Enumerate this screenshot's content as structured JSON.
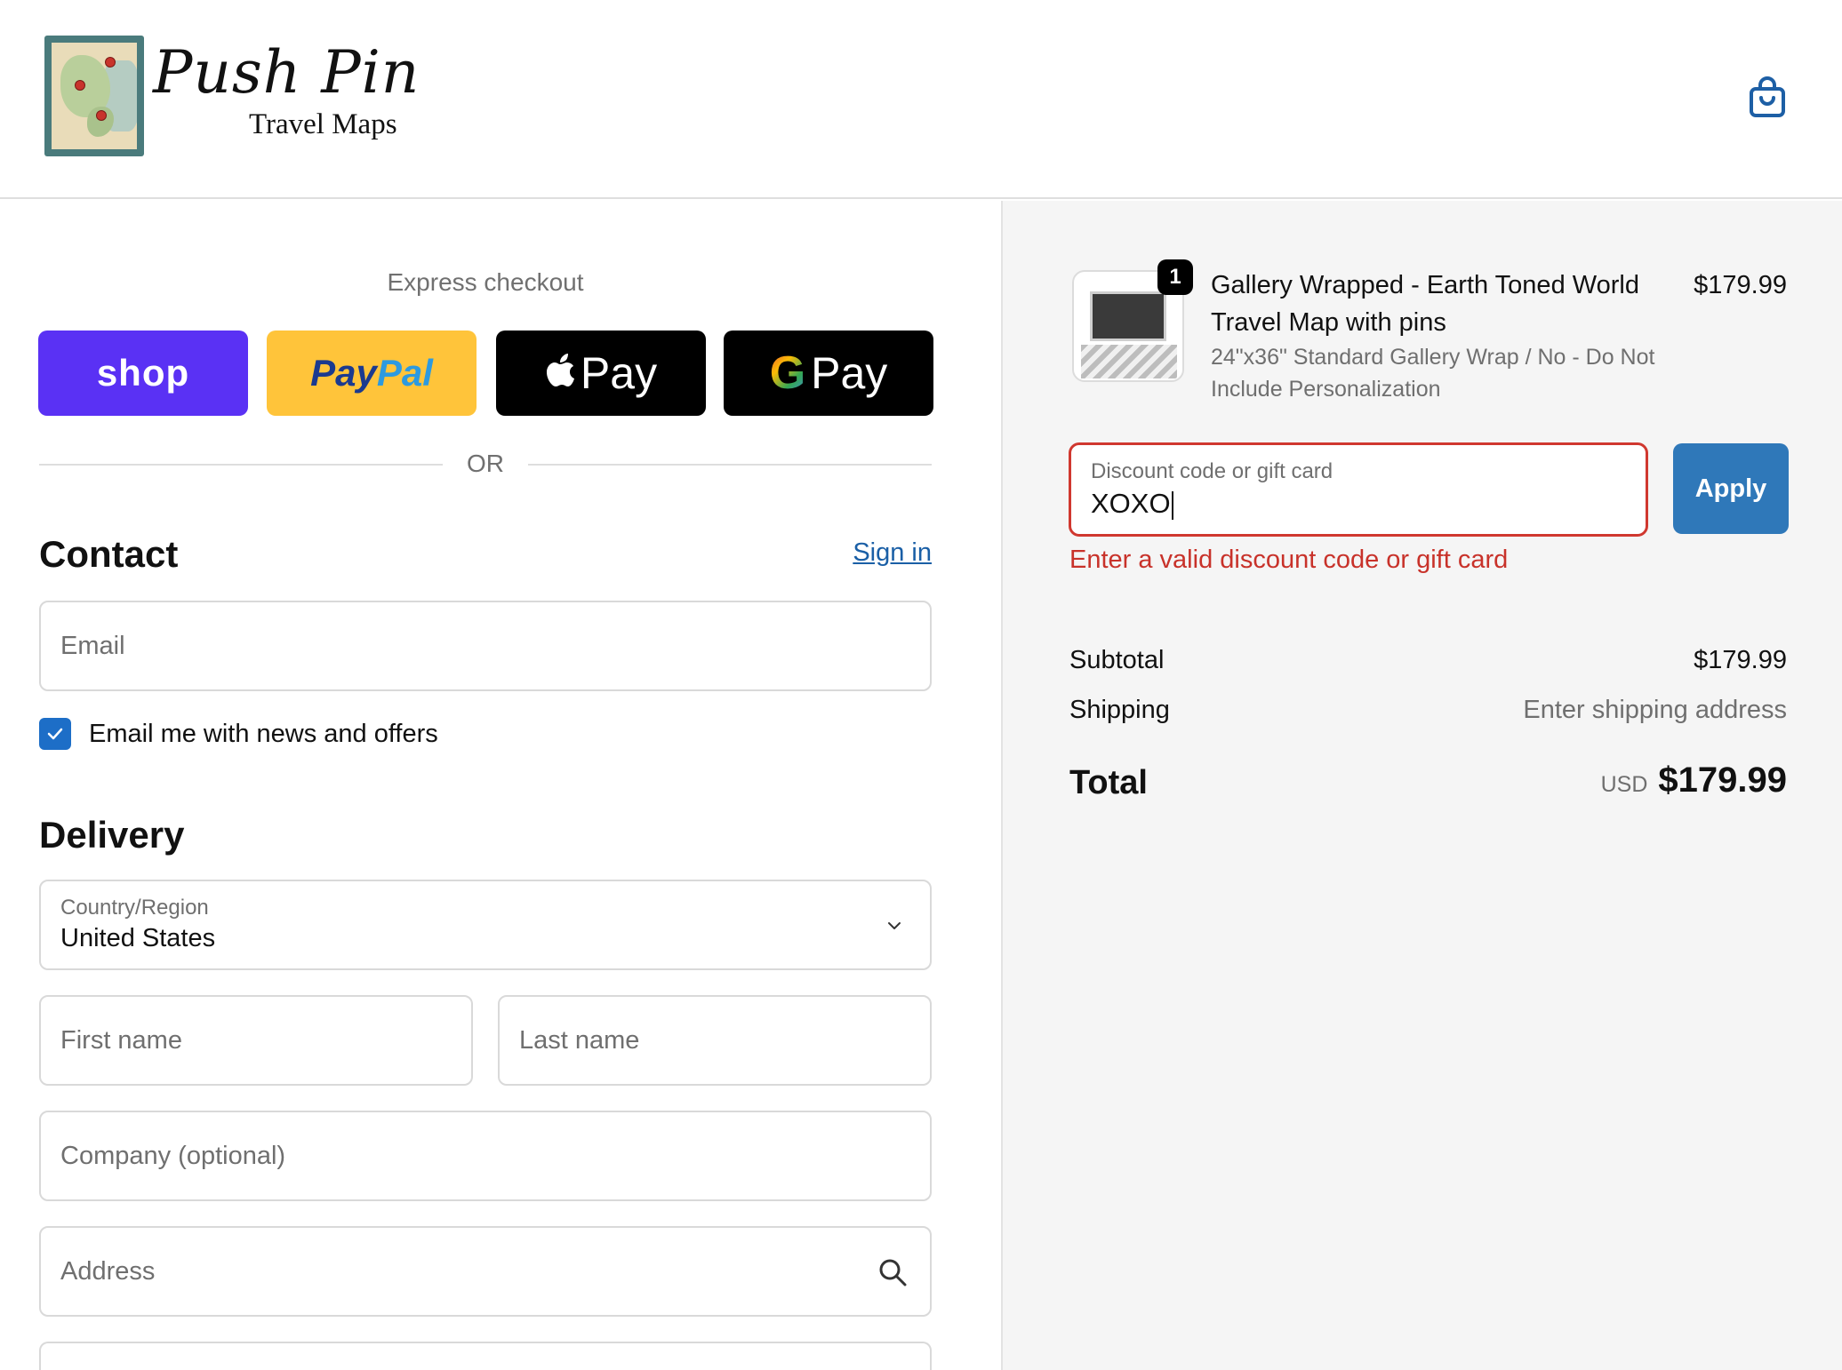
{
  "brand": {
    "name": "Push Pin",
    "tagline": "Travel Maps"
  },
  "header": {
    "cart_icon": "shopping-bag-icon"
  },
  "express": {
    "title": "Express checkout",
    "shop_label": "shop",
    "paypal_label_a": "Pay",
    "paypal_label_b": "Pal",
    "apple_label": "Pay",
    "gpay_g": "G",
    "gpay_label": "Pay",
    "or_label": "OR"
  },
  "contact": {
    "heading": "Contact",
    "sign_in": "Sign in",
    "email_placeholder": "Email",
    "newsletter_label": "Email me with news and offers",
    "newsletter_checked": true
  },
  "delivery": {
    "heading": "Delivery",
    "country_label": "Country/Region",
    "country_value": "United States",
    "first_name_placeholder": "First name",
    "last_name_placeholder": "Last name",
    "company_placeholder": "Company (optional)",
    "address_placeholder": "Address"
  },
  "order": {
    "quantity": "1",
    "product_title": "Gallery Wrapped - Earth Toned World Travel Map with pins",
    "product_variant": "24\"x36\" Standard Gallery Wrap / No - Do Not Include Personalization",
    "product_price": "$179.99"
  },
  "discount": {
    "label": "Discount code or gift card",
    "value": "XOXO",
    "apply_label": "Apply",
    "error": "Enter a valid discount code or gift card"
  },
  "totals": {
    "subtotal_label": "Subtotal",
    "subtotal_value": "$179.99",
    "shipping_label": "Shipping",
    "shipping_value": "Enter shipping address",
    "total_label": "Total",
    "currency": "USD",
    "total_value": "$179.99"
  },
  "colors": {
    "shop": "#5a31f4",
    "paypal": "#ffc43a",
    "apply": "#2f78b9",
    "error": "#c8322a",
    "checkbox": "#1d6ec7"
  }
}
